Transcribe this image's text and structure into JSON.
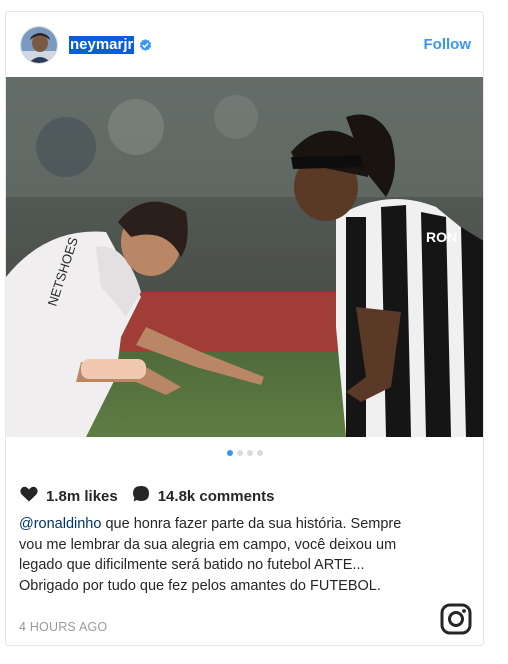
{
  "post": {
    "username": "neymarjr",
    "follow_label": "Follow",
    "likes": "1.8m likes",
    "comments": "14.8k comments",
    "caption_mention": "@ronaldinho",
    "caption_text": " que honra fazer parte da sua história. Sempre vou me lembrar da sua alegria em campo, você deixou um legado que dificilmente será batido no futebol ARTE... Obrigado por tudo que fez pelos amantes do FUTEBOL.",
    "timestamp": "4 HOURS AGO",
    "carousel": {
      "count": 4,
      "active": 0
    }
  },
  "colors": {
    "accent": "#3897f0",
    "text": "#262626",
    "muted": "#999999",
    "username_highlight": "#0a5fd4"
  },
  "icons": [
    "verified-badge-icon",
    "heart-icon",
    "comment-bubble-icon",
    "instagram-logo-icon"
  ]
}
